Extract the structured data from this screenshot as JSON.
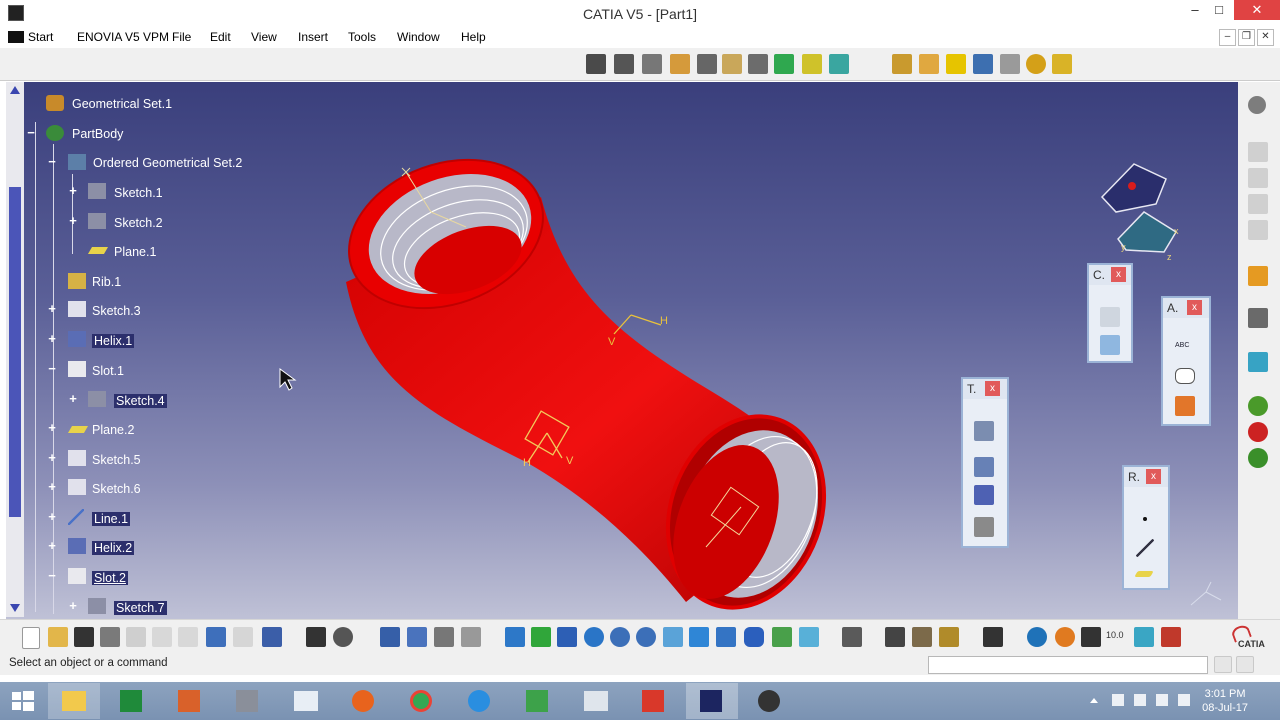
{
  "window": {
    "title": "CATIA V5 - [Part1]",
    "minimize": "–",
    "maximize": "□",
    "close": "✕"
  },
  "menubar": {
    "start": "Start",
    "items": [
      "ENOVIA V5 VPM",
      "File",
      "Edit",
      "View",
      "Insert",
      "Tools",
      "Window",
      "Help"
    ],
    "mdi_minimize": "–",
    "mdi_restore": "❐",
    "mdi_close": "✕"
  },
  "tree": {
    "items": [
      {
        "label": "Geometrical Set.1",
        "icon": "geometrical-set-icon"
      },
      {
        "label": "PartBody",
        "icon": "part-body-icon"
      },
      {
        "label": "Ordered Geometrical Set.2",
        "icon": "ordered-geometrical-set-icon"
      },
      {
        "label": "Sketch.1",
        "icon": "sketch-icon"
      },
      {
        "label": "Sketch.2",
        "icon": "sketch-icon"
      },
      {
        "label": "Plane.1",
        "icon": "plane-icon"
      },
      {
        "label": "Rib.1",
        "icon": "rib-icon"
      },
      {
        "label": "Sketch.3",
        "icon": "sketch-icon"
      },
      {
        "label": "Helix.1",
        "icon": "helix-icon"
      },
      {
        "label": "Slot.1",
        "icon": "slot-icon"
      },
      {
        "label": "Sketch.4",
        "icon": "sketch-icon"
      },
      {
        "label": "Plane.2",
        "icon": "plane-icon"
      },
      {
        "label": "Sketch.5",
        "icon": "sketch-icon"
      },
      {
        "label": "Sketch.6",
        "icon": "sketch-icon"
      },
      {
        "label": "Line.1",
        "icon": "line-icon"
      },
      {
        "label": "Helix.2",
        "icon": "helix-icon"
      },
      {
        "label": "Slot.2",
        "icon": "slot-icon"
      },
      {
        "label": "Sketch.7",
        "icon": "sketch-icon"
      }
    ]
  },
  "floating_toolbars": [
    {
      "title": "C.",
      "close": "x"
    },
    {
      "title": "A.",
      "close": "x"
    },
    {
      "title": "T.",
      "close": "x"
    },
    {
      "title": "R.",
      "close": "x"
    }
  ],
  "viewport": {
    "model_color": "#e00000",
    "plane_labels": {
      "h": "H",
      "v": "V"
    },
    "compass_labels": {
      "x": "x",
      "y": "y",
      "z": "z"
    }
  },
  "float_text": {
    "abc": "ABC",
    "ten": "10.0"
  },
  "statusbar": {
    "text": "Select an object or a command",
    "input_value": ""
  },
  "catia_logo": "CATIA",
  "taskbar": {
    "time": "3:01 PM",
    "date": "08-Jul-17"
  }
}
